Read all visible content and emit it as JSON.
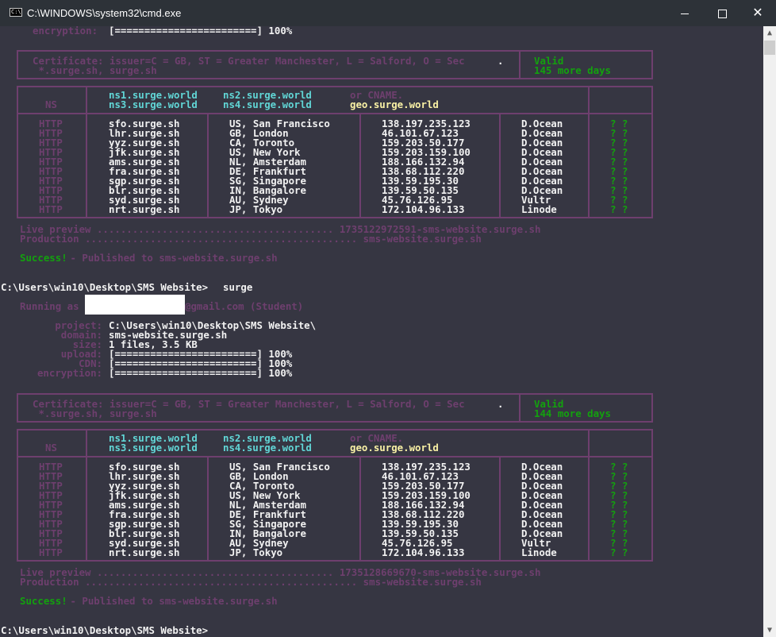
{
  "window": {
    "title": "C:\\WINDOWS\\system32\\cmd.exe",
    "icon": "console-icon",
    "controls": {
      "minimize": "minimize-icon",
      "maximize": "maximize-icon",
      "close": "close-icon"
    }
  },
  "colors": {
    "background": "#363642",
    "muted": "#6e3f6e",
    "text": "#f2f2f2",
    "success": "#13a10e",
    "nameserver": "#61d6d6",
    "cname": "#f9f1a5"
  },
  "top_fragment": {
    "encryption_label": "encryption:",
    "encryption_bar": "[========================] 100%"
  },
  "deploys": [
    {
      "certificate": {
        "issuer": "Certificate: issuer=C = GB, ST = Greater Manchester, L = Salford, O = Sec",
        "dot": ".",
        "domains": " *.surge.sh, surge.sh",
        "status": "Valid",
        "days": "145 more days"
      },
      "ns": {
        "label": "NS",
        "ns1": "ns1.surge.world",
        "ns2": "ns2.surge.world",
        "ns3": "ns3.surge.world",
        "ns4": "ns4.surge.world",
        "or_cname": "or CNAME.",
        "geo": "geo.surge.world"
      },
      "live_preview": "Live preview ........................................ 1735122972591-sms-website.surge.sh",
      "production": "Production .............................................. sms-website.surge.sh",
      "success_label": "Success!",
      "success_message": " - Published to sms-website.surge.sh"
    },
    {
      "certificate": {
        "issuer": "Certificate: issuer=C = GB, ST = Greater Manchester, L = Salford, O = Sec",
        "dot": ".",
        "domains": " *.surge.sh, surge.sh",
        "status": "Valid",
        "days": "144 more days"
      },
      "ns": {
        "label": "NS",
        "ns1": "ns1.surge.world",
        "ns2": "ns2.surge.world",
        "ns3": "ns3.surge.world",
        "ns4": "ns4.surge.world",
        "or_cname": "or CNAME.",
        "geo": "geo.surge.world"
      },
      "live_preview": "Live preview ........................................ 1735128669670-sms-website.surge.sh",
      "production": "Production .............................................. sms-website.surge.sh",
      "success_label": "Success!",
      "success_message": " - Published to sms-website.surge.sh"
    }
  ],
  "servers": [
    {
      "proto": "HTTP",
      "host": "sfo.surge.sh",
      "location": "US, San Francisco",
      "ip": "138.197.235.123",
      "provider": "D.Ocean",
      "status": "? ?"
    },
    {
      "proto": "HTTP",
      "host": "lhr.surge.sh",
      "location": "GB, London",
      "ip": "46.101.67.123",
      "provider": "D.Ocean",
      "status": "? ?"
    },
    {
      "proto": "HTTP",
      "host": "yyz.surge.sh",
      "location": "CA, Toronto",
      "ip": "159.203.50.177",
      "provider": "D.Ocean",
      "status": "? ?"
    },
    {
      "proto": "HTTP",
      "host": "jfk.surge.sh",
      "location": "US, New York",
      "ip": "159.203.159.100",
      "provider": "D.Ocean",
      "status": "? ?"
    },
    {
      "proto": "HTTP",
      "host": "ams.surge.sh",
      "location": "NL, Amsterdam",
      "ip": "188.166.132.94",
      "provider": "D.Ocean",
      "status": "? ?"
    },
    {
      "proto": "HTTP",
      "host": "fra.surge.sh",
      "location": "DE, Frankfurt",
      "ip": "138.68.112.220",
      "provider": "D.Ocean",
      "status": "? ?"
    },
    {
      "proto": "HTTP",
      "host": "sgp.surge.sh",
      "location": "SG, Singapore",
      "ip": "139.59.195.30",
      "provider": "D.Ocean",
      "status": "? ?"
    },
    {
      "proto": "HTTP",
      "host": "blr.surge.sh",
      "location": "IN, Bangalore",
      "ip": "139.59.50.135",
      "provider": "D.Ocean",
      "status": "? ?"
    },
    {
      "proto": "HTTP",
      "host": "syd.surge.sh",
      "location": "AU, Sydney",
      "ip": "45.76.126.95",
      "provider": "Vultr",
      "status": "? ?"
    },
    {
      "proto": "HTTP",
      "host": "nrt.surge.sh",
      "location": "JP, Tokyo",
      "ip": "172.104.96.133",
      "provider": "Linode",
      "status": "? ?"
    }
  ],
  "command": {
    "prompt": "C:\\Users\\win10\\Desktop\\SMS Website>",
    "input": "surge"
  },
  "running_as": {
    "prefix": "Running as ",
    "suffix": "@gmail.com (Student)"
  },
  "project_info": [
    {
      "label": "project:",
      "value": "C:\\Users\\win10\\Desktop\\SMS Website\\"
    },
    {
      "label": "domain:",
      "value": "sms-website.surge.sh"
    },
    {
      "label": "size:",
      "value": "1 files, 3.5 KB"
    },
    {
      "label": "upload:",
      "value": "[========================] 100%"
    },
    {
      "label": "CDN:",
      "value": "[========================] 100%"
    },
    {
      "label": "encryption:",
      "value": "[========================] 100%"
    }
  ],
  "final_prompt": "C:\\Users\\win10\\Desktop\\SMS Website>"
}
